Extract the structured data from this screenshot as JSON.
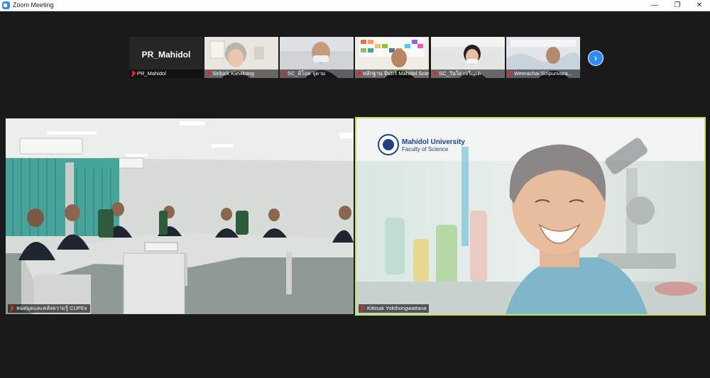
{
  "window": {
    "title": "Zoom Meeting",
    "minimize_glyph": "—",
    "maximize_glyph": "❐",
    "close_glyph": "✕"
  },
  "strip": {
    "next_glyph": "›",
    "participants": [
      {
        "name": "PR_Mahidol",
        "display": "PR_Mahidol"
      },
      {
        "name": "Siriluck Kievikong"
      },
      {
        "name": "SC_ดิโอด จุดาม"
      },
      {
        "name": "หลักฐาน จันทร์ Mahidol Scie..."
      },
      {
        "name": "SC_วันใส เจริญเด"
      },
      {
        "name": "Weerachai Siripunvara..."
      }
    ]
  },
  "main": {
    "left_name": "หอสมุดและคลังความรู้ CUPEx",
    "right_name": "Kittisak Yokthongwattana",
    "right_logo_title": "Mahidol University",
    "right_logo_sub": "Faculty of Science"
  },
  "colors": {
    "active_speaker": "#c8e05a",
    "zoom_blue": "#2d8cff",
    "mic_off": "#e02828"
  }
}
